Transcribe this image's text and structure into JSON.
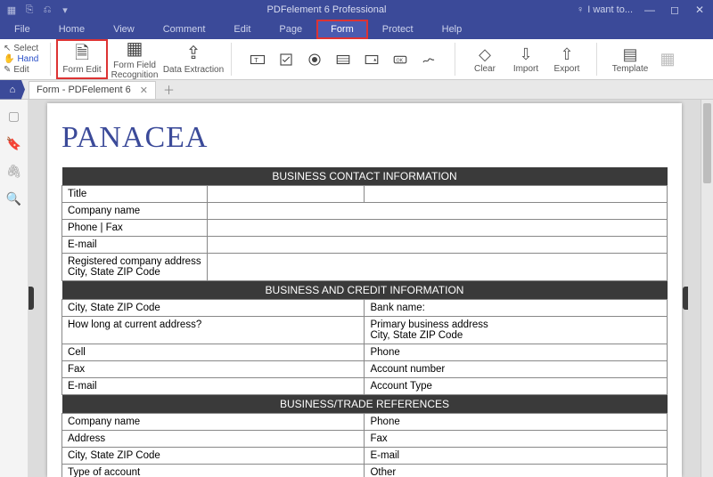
{
  "titlebar": {
    "title": "PDFelement 6 Professional",
    "wantto": "I want to..."
  },
  "menu": {
    "tabs": [
      "File",
      "Home",
      "View",
      "Comment",
      "Edit",
      "Page",
      "Form",
      "Protect",
      "Help"
    ],
    "active": "Form",
    "highlighted": "Form"
  },
  "ribbon": {
    "small": {
      "select": "Select",
      "hand": "Hand",
      "edit": "Edit"
    },
    "form_edit": "Form Edit",
    "form_field_recog": "Form Field\nRecognition",
    "data_extraction": "Data Extraction",
    "clear": "Clear",
    "import": "Import",
    "export": "Export",
    "template": "Template"
  },
  "doctab": {
    "name": "Form - PDFelement 6"
  },
  "form": {
    "brand": "PANACEA",
    "sec1": "BUSINESS CONTACT INFORMATION",
    "s1": {
      "title": "Title",
      "company_name": "Company name",
      "phone_fax": "Phone | Fax",
      "email": "E-mail",
      "reg_addr": "Registered company address\nCity, State ZIP Code"
    },
    "sec2": "BUSINESS AND CREDIT INFORMATION",
    "s2": {
      "city_zip": "City, State ZIP Code",
      "bank": "Bank name:",
      "howlong": "How long at current address?",
      "primary_addr": "Primary business address\nCity, State ZIP Code",
      "cell": "Cell",
      "phone": "Phone",
      "fax": "Fax",
      "acct_no": "Account number",
      "email": "E-mail",
      "acct_type": "Account Type"
    },
    "sec3": "BUSINESS/TRADE REFERENCES",
    "s3": {
      "company_name": "Company name",
      "phone": "Phone",
      "address": "Address",
      "fax": "Fax",
      "city_zip": "City, State ZIP Code",
      "email": "E-mail",
      "type_acct": "Type of account",
      "other": "Other"
    }
  }
}
